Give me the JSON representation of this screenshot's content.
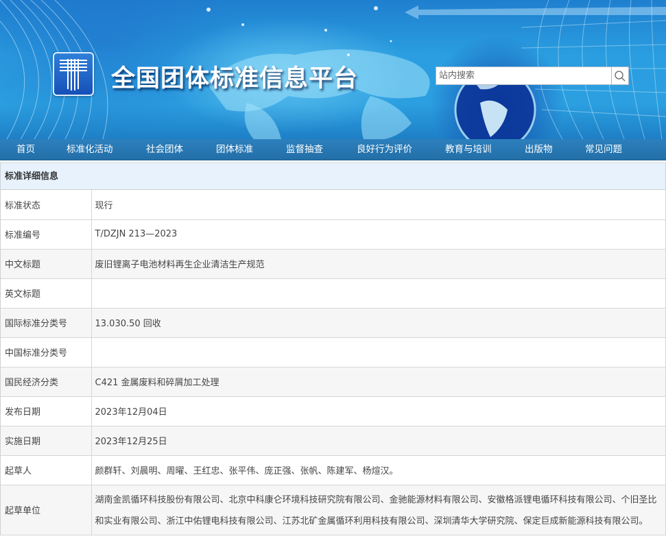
{
  "header": {
    "site_title": "全国团体标准信息平台",
    "logo_icon": "platform-logo-icon",
    "search": {
      "placeholder": "站内搜索",
      "value": "",
      "button_icon": "search-icon"
    }
  },
  "nav": {
    "items": [
      {
        "label": "首页"
      },
      {
        "label": "标准化活动"
      },
      {
        "label": "社会团体"
      },
      {
        "label": "团体标准"
      },
      {
        "label": "监督抽查"
      },
      {
        "label": "良好行为评价"
      },
      {
        "label": "教育与培训"
      },
      {
        "label": "出版物"
      },
      {
        "label": "常见问题"
      }
    ]
  },
  "detail": {
    "section_title": "标准详细信息",
    "rows": [
      {
        "label": "标准状态",
        "value": "现行"
      },
      {
        "label": "标准编号",
        "value": "T/DZJN 213—2023"
      },
      {
        "label": "中文标题",
        "value": "废旧锂离子电池材料再生企业清洁生产规范"
      },
      {
        "label": "英文标题",
        "value": ""
      },
      {
        "label": "国际标准分类号",
        "value": "13.030.50 回收"
      },
      {
        "label": "中国标准分类号",
        "value": ""
      },
      {
        "label": "国民经济分类",
        "value": "C421 金属废料和碎屑加工处理"
      },
      {
        "label": "发布日期",
        "value": "2023年12月04日"
      },
      {
        "label": "实施日期",
        "value": "2023年12月25日"
      },
      {
        "label": "起草人",
        "value": "颜群轩、刘晨明、周曜、王红忠、张平伟、庞正强、张帆、陈建军、杨煊汉。"
      },
      {
        "label": "起草单位",
        "value": "湖南金凯循环科技股份有限公司、北京中科康仑环境科技研究院有限公司、金驰能源材料有限公司、安徽格派锂电循环科技有限公司、个旧圣比和实业有限公司、浙江中佑锂电科技有限公司、江苏北矿金属循环利用科技有限公司、深圳清华大学研究院、保定巨成新能源科技有限公司。"
      }
    ]
  }
}
